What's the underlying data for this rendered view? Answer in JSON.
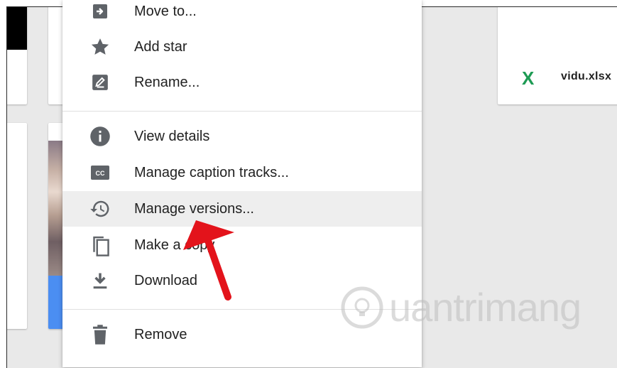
{
  "file_name": "vidu.xlsx",
  "file_icon_label": "X",
  "menu": {
    "items": [
      {
        "label": "Move to...",
        "icon": "move-to-icon"
      },
      {
        "label": "Add star",
        "icon": "star-icon"
      },
      {
        "label": "Rename...",
        "icon": "rename-icon"
      },
      {
        "label": "View details",
        "icon": "info-icon"
      },
      {
        "label": "Manage caption tracks...",
        "icon": "caption-icon"
      },
      {
        "label": "Manage versions...",
        "icon": "history-icon",
        "highlighted": true
      },
      {
        "label": "Make a copy",
        "icon": "copy-icon"
      },
      {
        "label": "Download",
        "icon": "download-icon"
      },
      {
        "label": "Remove",
        "icon": "trash-icon"
      }
    ]
  },
  "watermark": "uantrimang",
  "colors": {
    "accent_arrow": "#e3131b",
    "excel_green": "#1e9b54",
    "menu_highlight": "#eeeeee",
    "icon_gray": "#5f6368"
  }
}
